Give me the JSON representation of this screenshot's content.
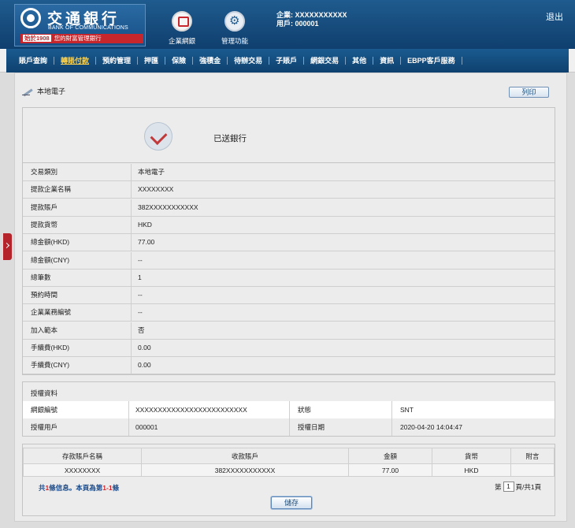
{
  "header": {
    "logo_cn": "交通銀行",
    "logo_en": "BANK OF COMMUNICATIONS",
    "since": "始於1908",
    "slogan": "您的財富管理銀行",
    "enterprise_label": "企業網銀",
    "manage_label": "管理功能",
    "enterprise_line": "企業: XXXXXXXXXXX",
    "user_line": "用戶: 000001",
    "logout": "退出"
  },
  "nav": {
    "items": [
      "賬戶查詢",
      "轉賬付款",
      "預約管理",
      "押匯",
      "保險",
      "強積金",
      "待辦交易",
      "子賬戶",
      "網銀交易",
      "其他",
      "資訊",
      "EBPP客戶服務"
    ],
    "active_index": 1
  },
  "page": {
    "title": "本地電子",
    "print_label": "列印",
    "status": "已送銀行"
  },
  "detail": [
    {
      "k": "交易類別",
      "v": "本地電子"
    },
    {
      "k": "提款企業名稱",
      "v": "XXXXXXXX"
    },
    {
      "k": "提款賬戶",
      "v": "382XXXXXXXXXXX"
    },
    {
      "k": "提款貨幣",
      "v": "HKD"
    },
    {
      "k": "總金額(HKD)",
      "v": "77.00"
    },
    {
      "k": "總金額(CNY)",
      "v": "--"
    },
    {
      "k": "總筆數",
      "v": "1"
    },
    {
      "k": "預約時間",
      "v": "--"
    },
    {
      "k": "企業業務編號",
      "v": "--"
    },
    {
      "k": "加入範本",
      "v": "否"
    },
    {
      "k": "手續費(HKD)",
      "v": "0.00"
    },
    {
      "k": "手續費(CNY)",
      "v": "0.00"
    }
  ],
  "auth": {
    "title": "授權資料",
    "ref_label": "網銀編號",
    "ref_value": "XXXXXXXXXXXXXXXXXXXXXXXXX",
    "status_label": "狀態",
    "status_value": "SNT",
    "user_label": "授權用戶",
    "user_value": "000001",
    "date_label": "授權日期",
    "date_value": "2020-04-20 14:04:47"
  },
  "table": {
    "headers": [
      "存款賬戶名稱",
      "收款賬戶",
      "金額",
      "貨幣",
      "附言"
    ],
    "rows": [
      [
        "XXXXXXXX",
        "382XXXXXXXXXXX",
        "77.00",
        "HKD",
        ""
      ]
    ]
  },
  "summary": {
    "prefix": "共",
    "count": "1",
    "mid": "條信息。本頁為第",
    "range": "1-1",
    "suffix": "條"
  },
  "pager": {
    "pre": "第",
    "page": "1",
    "post": "頁/共1頁"
  },
  "save_label": "儲存"
}
